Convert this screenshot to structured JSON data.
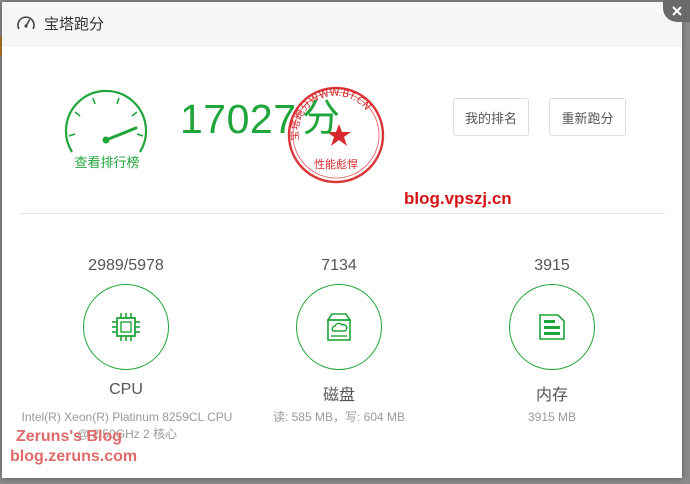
{
  "dialog": {
    "title": "宝塔跑分",
    "close_icon": "close-icon"
  },
  "score": {
    "total": "17027",
    "unit": "分",
    "gauge_link": "查看排行榜",
    "seal_text": "宝塔跑分WWW.BT.CN",
    "seal_subtext": "性能彪悍"
  },
  "buttons": {
    "rank": "我的排名",
    "retest": "重新跑分"
  },
  "watermarks": {
    "site1": "blog.vpszj.cn",
    "site2_title": "Zeruns's Blog",
    "site2_url": "blog.zeruns.com"
  },
  "metrics": [
    {
      "value": "2989/5978",
      "name": "CPU",
      "detail": "Intel(R) Xeon(R) Platinum 8259CL CPU @ 2.50GHz 2 核心",
      "icon": "cpu-icon"
    },
    {
      "value": "7134",
      "name": "磁盘",
      "detail": "读: 585 MB，写: 604 MB",
      "icon": "disk-icon"
    },
    {
      "value": "3915",
      "name": "内存",
      "detail": "3915 MB",
      "icon": "memory-icon"
    }
  ],
  "colors": {
    "accent": "#20a53a",
    "seal": "#d41216",
    "watermark": "#e06a6a"
  }
}
